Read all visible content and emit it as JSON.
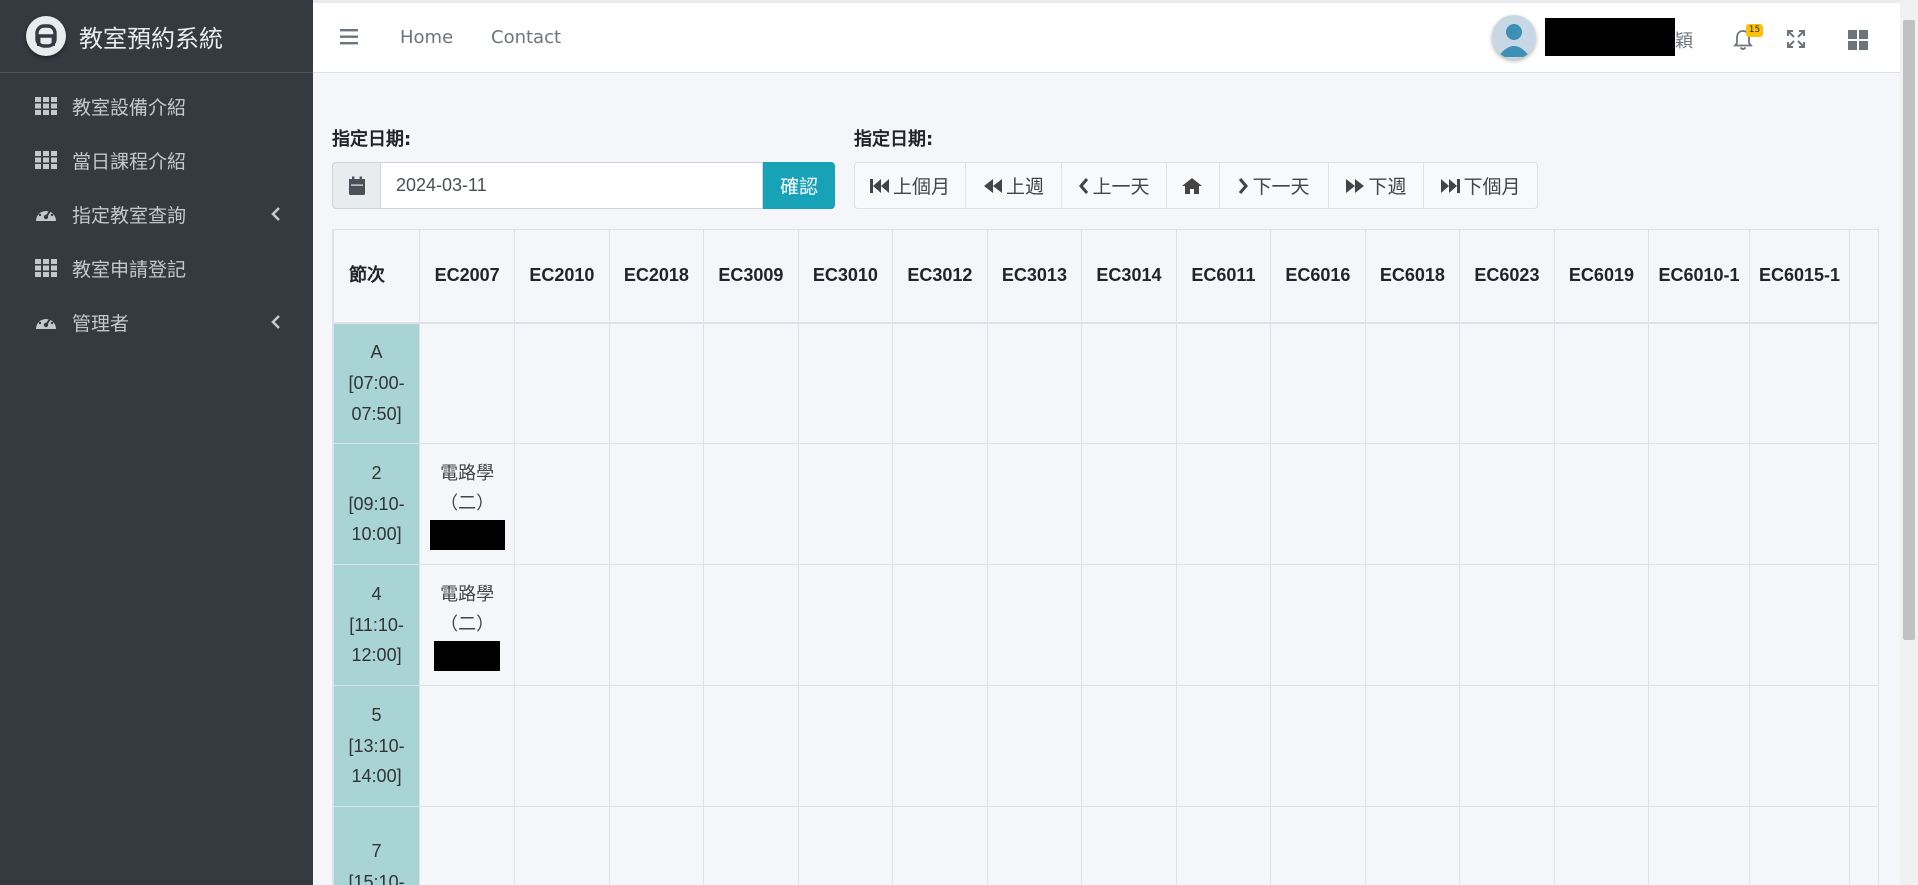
{
  "brand": {
    "title": "教室預約系統"
  },
  "sidebar": {
    "items": [
      {
        "label": "教室設備介紹",
        "icon": "grid-icon",
        "has_arrow": false
      },
      {
        "label": "當日課程介紹",
        "icon": "grid-icon",
        "has_arrow": false
      },
      {
        "label": "指定教室查詢",
        "icon": "dashboard-icon",
        "has_arrow": true
      },
      {
        "label": "教室申請登記",
        "icon": "grid-icon",
        "has_arrow": false
      },
      {
        "label": "管理者",
        "icon": "dashboard-icon",
        "has_arrow": true
      }
    ]
  },
  "topbar": {
    "home": "Home",
    "contact": "Contact",
    "user_name_suffix": "穎",
    "notification_count": "15"
  },
  "controls": {
    "date_label_left": "指定日期:",
    "date_label_right": "指定日期:",
    "date_value": "2024-03-11",
    "confirm": "確認",
    "nav_buttons": {
      "prev_month": "上個月",
      "prev_week": "上週",
      "prev_day": "上一天",
      "next_day": "下一天",
      "next_week": "下週",
      "next_month": "下個月"
    }
  },
  "table": {
    "period_header": "節次",
    "rooms": [
      "EC2007",
      "EC2010",
      "EC2018",
      "EC3009",
      "EC3010",
      "EC3012",
      "EC3013",
      "EC3014",
      "EC6011",
      "EC6016",
      "EC6018",
      "EC6023",
      "EC6019",
      "EC6010-1",
      "EC6015-1"
    ],
    "rows": [
      {
        "period": "A",
        "time": "[07:00-07:50]",
        "course": ""
      },
      {
        "period": "2",
        "time": "[09:10-10:00]",
        "course": "電路學（二）"
      },
      {
        "period": "4",
        "time": "[11:10-12:00]",
        "course": "電路學（二）"
      },
      {
        "period": "5",
        "time": "[13:10-14:00]",
        "course": ""
      },
      {
        "period": "7",
        "time": "[15:10-",
        "course": ""
      }
    ]
  },
  "colors": {
    "sidebar_bg": "#343a40",
    "accent": "#17a2b8",
    "period_bg": "#a8d4d6",
    "badge": "#ffc107"
  }
}
